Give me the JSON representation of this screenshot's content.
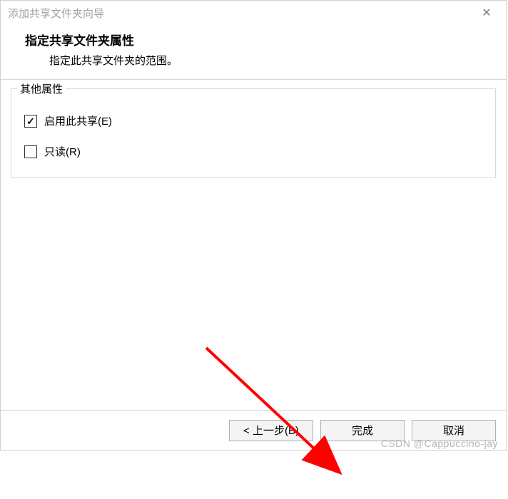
{
  "window": {
    "title": "添加共享文件夹向导",
    "close_label": "✕"
  },
  "header": {
    "heading": "指定共享文件夹属性",
    "subtext": "指定此共享文件夹的范围。"
  },
  "fieldset": {
    "legend": "其他属性",
    "options": [
      {
        "label": "启用此共享(E)",
        "checked": true
      },
      {
        "label": "只读(R)",
        "checked": false
      }
    ]
  },
  "footer": {
    "back": "< 上一步(B)",
    "finish": "完成",
    "cancel": "取消"
  },
  "annotation": {
    "arrow_color": "#ff0000"
  },
  "watermark": "CSDN @Cappuccino-jay"
}
